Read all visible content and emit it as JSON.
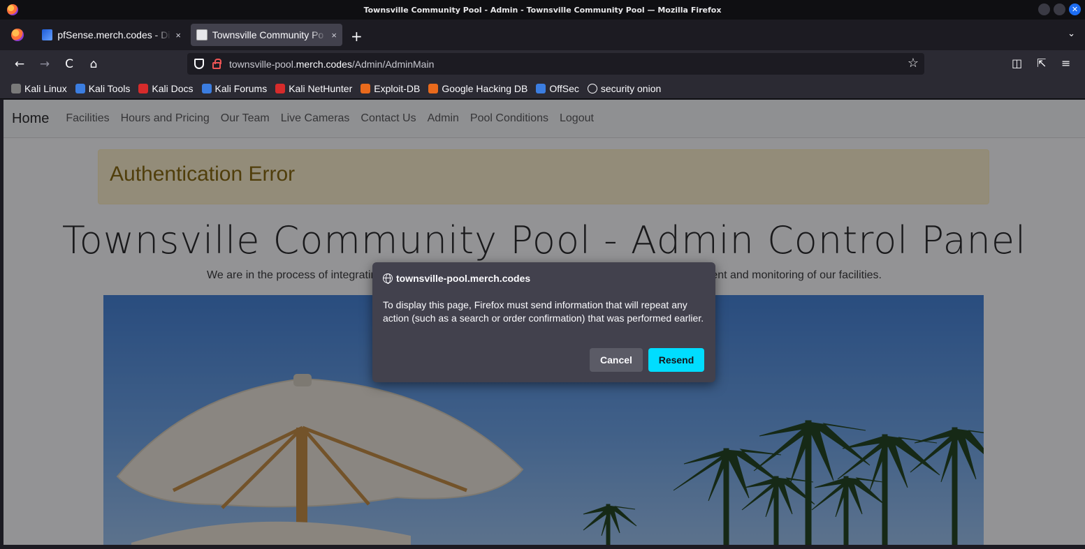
{
  "window": {
    "title": "Townsville Community Pool - Admin - Townsville Community Pool — Mozilla Firefox"
  },
  "tabs": [
    {
      "label": "pfSense.merch.codes - Di",
      "close": "×"
    },
    {
      "label": "Townsville Community Po",
      "close": "×"
    }
  ],
  "newtab": "+",
  "tablist": "⌄",
  "toolbar": {
    "back": "←",
    "forward": "→",
    "reload": "C",
    "home": "⌂"
  },
  "urlbar": {
    "prefix": "townsville-pool.",
    "domain": "merch.codes",
    "path": "/Admin/AdminMain",
    "star": "☆"
  },
  "bookmarks": [
    {
      "label": "Kali Linux",
      "color": "#7a7a7a"
    },
    {
      "label": "Kali Tools",
      "color": "#3b7de0"
    },
    {
      "label": "Kali Docs",
      "color": "#d62b2b"
    },
    {
      "label": "Kali Forums",
      "color": "#3b7de0"
    },
    {
      "label": "Kali NetHunter",
      "color": "#d62b2b"
    },
    {
      "label": "Exploit-DB",
      "color": "#e96a1c"
    },
    {
      "label": "Google Hacking DB",
      "color": "#e96a1c"
    },
    {
      "label": "OffSec",
      "color": "#3b7de0"
    },
    {
      "label": "security onion",
      "color": "#fbfbfe"
    }
  ],
  "site": {
    "brand": "Home",
    "nav": [
      "Facilities",
      "Hours and Pricing",
      "Our Team",
      "Live Cameras",
      "Contact Us",
      "Admin",
      "Pool Conditions",
      "Logout"
    ],
    "alert": "Authentication Error",
    "title": "Townsville Community Pool - Admin Control Panel",
    "lead_left": "We are in the process of integrating",
    "lead_right": "ent and monitoring of our facilities."
  },
  "dialog": {
    "origin": "townsville-pool.merch.codes",
    "message": "To display this page, Firefox must send information that will repeat any action (such as a search or order confirmation) that was performed earlier.",
    "cancel": "Cancel",
    "resend": "Resend"
  },
  "colors": {
    "accent": "#00ddff",
    "alert_bg": "#fff3cd",
    "alert_text": "#856404"
  }
}
